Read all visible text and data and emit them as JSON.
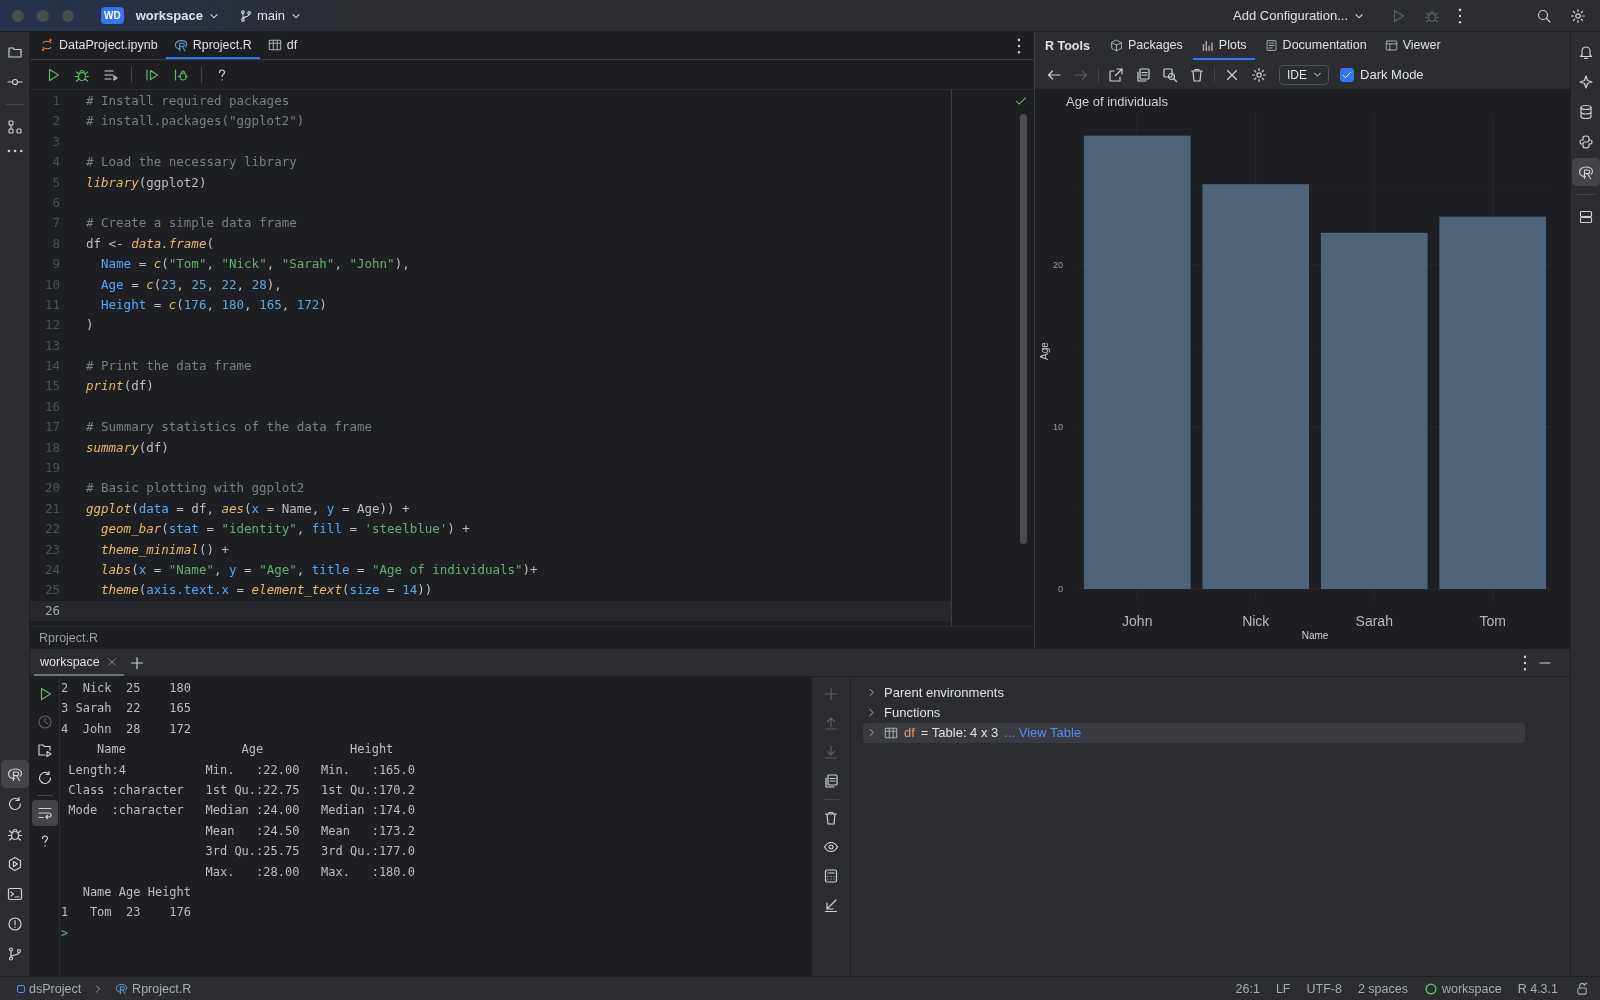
{
  "title_bar": {
    "project_badge": "WD",
    "project": "workspace",
    "branch": "main",
    "run_config": "Add Configuration..."
  },
  "left_strip": {
    "top": [
      {
        "selected": false
      },
      {
        "selected": false
      },
      {
        "selected": false
      },
      {
        "selected": false
      }
    ],
    "bottom": [
      {
        "selected": true
      },
      {
        "selected": false
      },
      {
        "selected": false
      },
      {
        "selected": false
      },
      {
        "selected": false
      },
      {
        "selected": false
      },
      {
        "selected": false
      }
    ]
  },
  "editor": {
    "tabs": [
      {
        "label": "DataProject.ipynb",
        "kind": "notebook",
        "selected": false
      },
      {
        "label": "Rproject.R",
        "kind": "r",
        "selected": true
      },
      {
        "label": "df",
        "kind": "table",
        "selected": false
      }
    ],
    "lines": [
      {
        "number": "1",
        "current": false,
        "tokens": [
          {
            "kind": "comment",
            "text": "# Install required packages"
          }
        ]
      },
      {
        "number": "2",
        "current": false,
        "tokens": [
          {
            "kind": "comment",
            "text": "# install.packages(\"ggplot2\")"
          }
        ]
      },
      {
        "number": "3",
        "current": false
      },
      {
        "number": "4",
        "current": false,
        "tokens": [
          {
            "kind": "comment",
            "text": "# Load the necessary library"
          }
        ]
      },
      {
        "number": "5",
        "current": false,
        "tokens": [
          {
            "kind": "func",
            "text": "library"
          },
          {
            "kind": "plain",
            "text": "(ggplot2)"
          }
        ]
      },
      {
        "number": "6",
        "current": false
      },
      {
        "number": "7",
        "current": false,
        "tokens": [
          {
            "kind": "comment",
            "text": "# Create a simple data frame"
          }
        ]
      },
      {
        "number": "8",
        "current": false,
        "tokens": [
          {
            "kind": "plain",
            "text": "df <- "
          },
          {
            "kind": "func",
            "text": "data.frame"
          },
          {
            "kind": "plain",
            "text": "("
          }
        ]
      },
      {
        "number": "9",
        "current": false,
        "indented": true,
        "tokens": [
          {
            "kind": "param",
            "text": "Name"
          },
          {
            "kind": "plain",
            "text": " = "
          },
          {
            "kind": "func",
            "text": "c"
          },
          {
            "kind": "plain",
            "text": "("
          },
          {
            "kind": "string",
            "text": "\"Tom\""
          },
          {
            "kind": "plain",
            "text": ", "
          },
          {
            "kind": "string",
            "text": "\"Nick\""
          },
          {
            "kind": "plain",
            "text": ", "
          },
          {
            "kind": "string",
            "text": "\"Sarah\""
          },
          {
            "kind": "plain",
            "text": ", "
          },
          {
            "kind": "string",
            "text": "\"John\""
          },
          {
            "kind": "plain",
            "text": "),"
          }
        ]
      },
      {
        "number": "10",
        "current": false,
        "indented": true,
        "tokens": [
          {
            "kind": "param",
            "text": "Age"
          },
          {
            "kind": "plain",
            "text": " = "
          },
          {
            "kind": "func",
            "text": "c"
          },
          {
            "kind": "plain",
            "text": "("
          },
          {
            "kind": "number",
            "text": "23"
          },
          {
            "kind": "plain",
            "text": ", "
          },
          {
            "kind": "number",
            "text": "25"
          },
          {
            "kind": "plain",
            "text": ", "
          },
          {
            "kind": "number",
            "text": "22"
          },
          {
            "kind": "plain",
            "text": ", "
          },
          {
            "kind": "number",
            "text": "28"
          },
          {
            "kind": "plain",
            "text": "),"
          }
        ]
      },
      {
        "number": "11",
        "current": false,
        "indented": true,
        "tokens": [
          {
            "kind": "param",
            "text": "Height"
          },
          {
            "kind": "plain",
            "text": " = "
          },
          {
            "kind": "func",
            "text": "c"
          },
          {
            "kind": "plain",
            "text": "("
          },
          {
            "kind": "number",
            "text": "176"
          },
          {
            "kind": "plain",
            "text": ", "
          },
          {
            "kind": "number",
            "text": "180"
          },
          {
            "kind": "plain",
            "text": ", "
          },
          {
            "kind": "number",
            "text": "165"
          },
          {
            "kind": "plain",
            "text": ", "
          },
          {
            "kind": "number",
            "text": "172"
          },
          {
            "kind": "plain",
            "text": ")"
          }
        ]
      },
      {
        "number": "12",
        "current": false,
        "tokens": [
          {
            "kind": "plain",
            "text": ")"
          }
        ]
      },
      {
        "number": "13",
        "current": false
      },
      {
        "number": "14",
        "current": false,
        "tokens": [
          {
            "kind": "comment",
            "text": "# Print the data frame"
          }
        ]
      },
      {
        "number": "15",
        "current": false,
        "tokens": [
          {
            "kind": "func",
            "text": "print"
          },
          {
            "kind": "plain",
            "text": "(df)"
          }
        ]
      },
      {
        "number": "16",
        "current": false
      },
      {
        "number": "17",
        "current": false,
        "tokens": [
          {
            "kind": "comment",
            "text": "# Summary statistics of the data frame"
          }
        ]
      },
      {
        "number": "18",
        "current": false,
        "tokens": [
          {
            "kind": "func",
            "text": "summary"
          },
          {
            "kind": "plain",
            "text": "(df)"
          }
        ]
      },
      {
        "number": "19",
        "current": false
      },
      {
        "number": "20",
        "current": false,
        "tokens": [
          {
            "kind": "comment",
            "text": "# Basic plotting with ggplot2"
          }
        ]
      },
      {
        "number": "21",
        "current": false,
        "tokens": [
          {
            "kind": "func",
            "text": "ggplot"
          },
          {
            "kind": "plain",
            "text": "("
          },
          {
            "kind": "param",
            "text": "data"
          },
          {
            "kind": "plain",
            "text": " = df, "
          },
          {
            "kind": "func",
            "text": "aes"
          },
          {
            "kind": "plain",
            "text": "("
          },
          {
            "kind": "param",
            "text": "x"
          },
          {
            "kind": "plain",
            "text": " = Name, "
          },
          {
            "kind": "param",
            "text": "y"
          },
          {
            "kind": "plain",
            "text": " = Age)) +"
          }
        ]
      },
      {
        "number": "22",
        "current": false,
        "indented": true,
        "tokens": [
          {
            "kind": "func",
            "text": "geom_bar"
          },
          {
            "kind": "plain",
            "text": "("
          },
          {
            "kind": "param",
            "text": "stat"
          },
          {
            "kind": "plain",
            "text": " = "
          },
          {
            "kind": "string",
            "text": "\"identity\""
          },
          {
            "kind": "plain",
            "text": ", "
          },
          {
            "kind": "param",
            "text": "fill"
          },
          {
            "kind": "plain",
            "text": " = "
          },
          {
            "kind": "string",
            "text": "'steelblue'"
          },
          {
            "kind": "plain",
            "text": ") +"
          }
        ]
      },
      {
        "number": "23",
        "current": false,
        "indented": true,
        "tokens": [
          {
            "kind": "func",
            "text": "theme_minimal"
          },
          {
            "kind": "plain",
            "text": "() +"
          }
        ]
      },
      {
        "number": "24",
        "current": false,
        "indented": true,
        "tokens": [
          {
            "kind": "func",
            "text": "labs"
          },
          {
            "kind": "plain",
            "text": "("
          },
          {
            "kind": "param",
            "text": "x"
          },
          {
            "kind": "plain",
            "text": " = "
          },
          {
            "kind": "string",
            "text": "\"Name\""
          },
          {
            "kind": "plain",
            "text": ", "
          },
          {
            "kind": "param",
            "text": "y"
          },
          {
            "kind": "plain",
            "text": " = "
          },
          {
            "kind": "string",
            "text": "\"Age\""
          },
          {
            "kind": "plain",
            "text": ", "
          },
          {
            "kind": "param",
            "text": "title"
          },
          {
            "kind": "plain",
            "text": " = "
          },
          {
            "kind": "string",
            "text": "\"Age of individuals\""
          },
          {
            "kind": "plain",
            "text": ")+"
          }
        ]
      },
      {
        "number": "25",
        "current": false,
        "indented": true,
        "tokens": [
          {
            "kind": "func",
            "text": "theme"
          },
          {
            "kind": "plain",
            "text": "("
          },
          {
            "kind": "param",
            "text": "axis.text.x"
          },
          {
            "kind": "plain",
            "text": " = "
          },
          {
            "kind": "func",
            "text": "element_text"
          },
          {
            "kind": "plain",
            "text": "("
          },
          {
            "kind": "param",
            "text": "size"
          },
          {
            "kind": "plain",
            "text": " = "
          },
          {
            "kind": "number",
            "text": "14"
          },
          {
            "kind": "plain",
            "text": "))"
          }
        ]
      },
      {
        "number": "26",
        "current": true
      }
    ],
    "breadcrumb": "Rproject.R"
  },
  "plots": {
    "title": "R Tools",
    "tabs": [
      {
        "label": "Packages",
        "selected": false
      },
      {
        "label": "Plots",
        "selected": true
      },
      {
        "label": "Documentation",
        "selected": false
      },
      {
        "label": "Viewer",
        "selected": false
      }
    ],
    "renderer": "IDE",
    "dark_mode": {
      "label": "Dark Mode",
      "checked": true
    },
    "chart_data": {
      "type": "bar",
      "title": "Age of individuals",
      "xlabel": "Name",
      "ylabel": "Age",
      "categories": [
        "John",
        "Nick",
        "Sarah",
        "Tom"
      ],
      "values": [
        28,
        25,
        22,
        23
      ],
      "ylim": [
        0,
        29.4
      ],
      "yticks": [
        0,
        10,
        20
      ],
      "grid": true
    }
  },
  "right_strip": [
    {
      "selected": false
    },
    {
      "selected": false
    },
    {
      "selected": false
    },
    {
      "selected": false
    },
    {
      "selected": true
    },
    {
      "selected": false
    }
  ],
  "console": {
    "tabs": [
      {
        "label": "workspace",
        "selected": true
      }
    ],
    "lines": [
      "2  Nick  25    180",
      "3 Sarah  22    165",
      "4  John  28    172",
      "     Name                Age            Height",
      " Length:4           Min.   :22.00   Min.   :165.0",
      " Class :character   1st Qu.:22.75   1st Qu.:170.2",
      " Mode  :character   Median :24.00   Median :174.0",
      "                    Mean   :24.50   Mean   :173.2",
      "                    3rd Qu.:25.75   3rd Qu.:177.0",
      "                    Max.   :28.00   Max.   :180.0",
      "   Name Age Height",
      "1   Tom  23    176"
    ],
    "prompt": ">",
    "tool_buttons": [
      {
        "selected": false
      },
      {
        "selected": false
      },
      {
        "selected": false
      },
      {
        "selected": false
      },
      {
        "selected": true
      },
      {
        "selected": false
      }
    ]
  },
  "variables": {
    "items": [
      {
        "kind": "group",
        "label": "Parent environments",
        "expanded": false,
        "selected": false
      },
      {
        "kind": "group",
        "label": "Functions",
        "expanded": false,
        "selected": false
      },
      {
        "kind": "table",
        "name": "df",
        "value": "= Table: 4 x 3",
        "link": "... View Table",
        "expanded": false,
        "selected": true
      }
    ]
  },
  "status_bar": {
    "breadcrumb": [
      "dsProject",
      "Rproject.R"
    ],
    "position": "26:1",
    "line_ending": "LF",
    "encoding": "UTF-8",
    "indent": "2 spaces",
    "interpreter": "workspace",
    "version": "R 4.3.1"
  }
}
